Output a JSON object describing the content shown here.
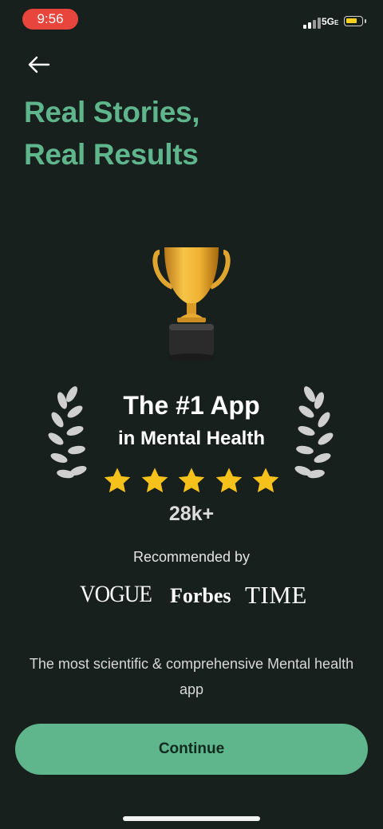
{
  "status_bar": {
    "time": "9:56",
    "network": "5G",
    "time_pill_color": "#e8453c",
    "battery_color": "#f5d020"
  },
  "header": {
    "back_icon": "arrow-left-icon",
    "title_line1": "Real Stories,",
    "title_line2": "Real Results",
    "title_color": "#5fb68c"
  },
  "award": {
    "trophy_icon": "trophy-icon",
    "laurel_icon": "laurel-wreath-icon",
    "title": "The #1 App",
    "subtitle": "in Mental Health",
    "star_icon": "star-icon",
    "rating_stars": 5,
    "rating_count": "28k+"
  },
  "recommended": {
    "label": "Recommended by",
    "brands": [
      "VOGUE",
      "Forbes",
      "TIME"
    ]
  },
  "description": "The most scientific & comprehensive Mental health app",
  "cta": {
    "label": "Continue",
    "color": "#5fb68c"
  }
}
